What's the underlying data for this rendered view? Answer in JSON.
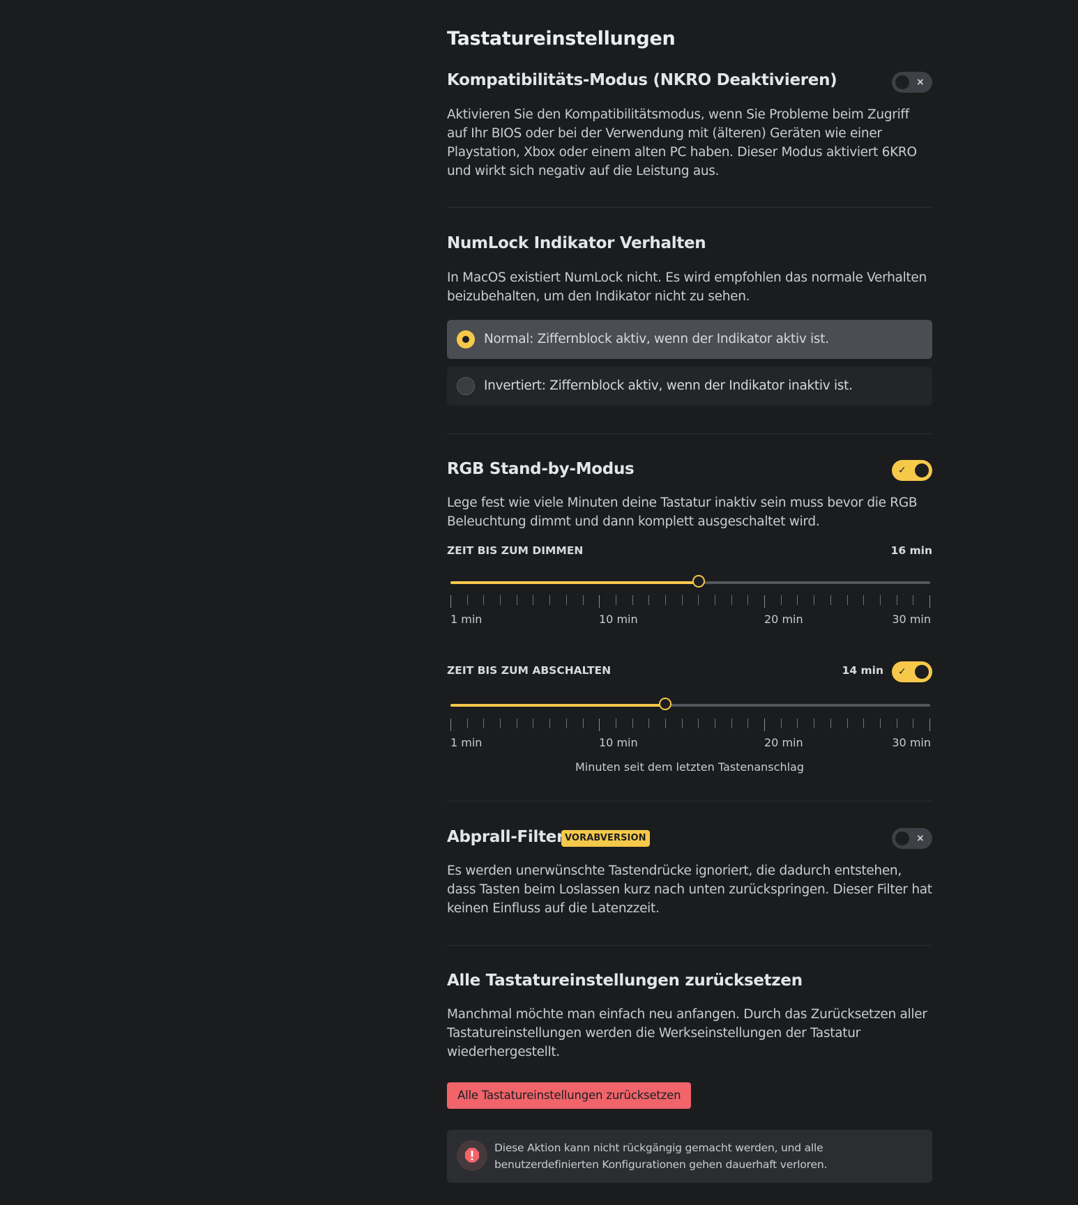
{
  "page": {
    "title": "Tastatureinstellungen"
  },
  "compat": {
    "title": "Kompatibilitäts-Modus (NKRO Deaktivieren)",
    "toggle_on": false,
    "toggle_off_mark": "×",
    "description": "Aktivieren Sie den Kompatibilitätsmodus, wenn Sie Probleme beim Zugriff auf Ihr BIOS oder bei der Verwendung mit (älteren) Geräten wie einer Playstation, Xbox oder einem alten PC haben. Dieser Modus aktiviert 6KRO und wirkt sich negativ auf die Leistung aus."
  },
  "numlock": {
    "title": "NumLock Indikator Verhalten",
    "description": "In MacOS existiert NumLock nicht. Es wird empfohlen das normale Verhalten beizubehalten, um den Indikator nicht zu sehen.",
    "options": [
      {
        "label": "Normal: Ziffernblock aktiv, wenn der Indikator aktiv ist.",
        "selected": true
      },
      {
        "label": "Invertiert: Ziffernblock aktiv, wenn der Indikator inaktiv ist.",
        "selected": false
      }
    ]
  },
  "rgb_standby": {
    "title": "RGB Stand-by-Modus",
    "toggle_on": true,
    "toggle_on_mark": "✓",
    "description": "Lege fest wie viele Minuten deine Tastatur inaktiv sein muss bevor die RGB Beleuchtung dimmt und dann komplett ausgeschaltet wird.",
    "dim": {
      "label": "ZEIT BIS ZUM DIMMEN",
      "value_label": "16 min",
      "value": 16,
      "min": 1,
      "max": 30,
      "tick_labels": [
        "1 min",
        "10 min",
        "20 min",
        "30 min"
      ]
    },
    "off": {
      "label": "ZEIT BIS ZUM ABSCHALTEN",
      "value_label": "14 min",
      "value": 14,
      "min": 1,
      "max": 30,
      "toggle_on": true,
      "tick_labels": [
        "1 min",
        "10 min",
        "20 min",
        "30 min"
      ],
      "helper": "Minuten seit dem letzten Tastenanschlag"
    }
  },
  "debounce": {
    "title": "Abprall-Filter",
    "badge": "VORABVERSION",
    "toggle_on": false,
    "description": "Es werden unerwünschte Tastendrücke ignoriert, die dadurch entstehen, dass Tasten beim Loslassen kurz nach unten zurückspringen. Dieser Filter hat keinen Einfluss auf die Latenzzeit."
  },
  "reset": {
    "title": "Alle Tastatureinstellungen zurücksetzen",
    "description": "Manchmal möchte man einfach neu anfangen. Durch das Zurücksetzen aller Tastatureinstellungen werden die Werkseinstellungen der Tastatur wiederhergestellt.",
    "button_label": "Alle Tastatureinstellungen zurücksetzen",
    "warning": "Diese Aktion kann nicht rückgängig gemacht werden, und alle benutzerdefinierten Konfigurationen gehen dauerhaft verloren."
  },
  "colors": {
    "accent": "#f6c94a",
    "danger": "#f0646a",
    "background": "#1b1c1e"
  }
}
